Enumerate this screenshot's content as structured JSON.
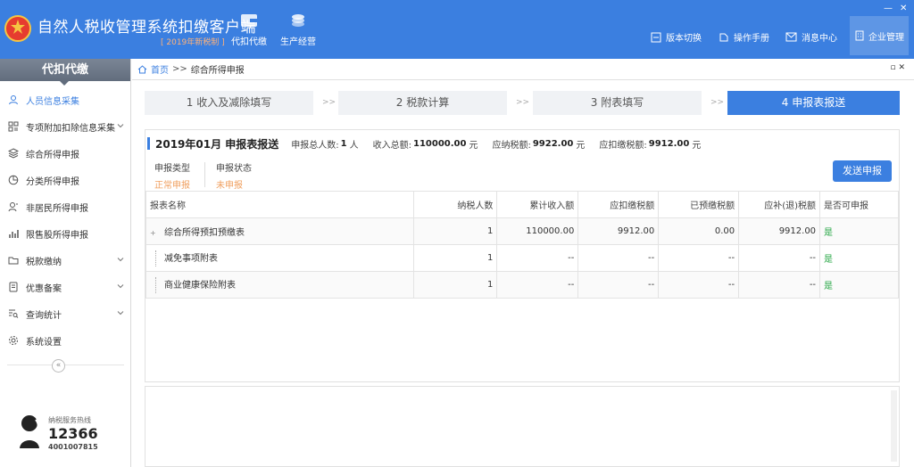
{
  "header": {
    "app_title": "自然人税收管理系统扣缴客户端",
    "edition": "[ 2019年新税制 ]",
    "nav": [
      {
        "label": "代扣代缴",
        "icon": "wallet-icon"
      },
      {
        "label": "生产经营",
        "icon": "coins-icon"
      }
    ],
    "links": [
      {
        "label": "版本切换",
        "icon": "switch-icon"
      },
      {
        "label": "操作手册",
        "icon": "manual-icon"
      },
      {
        "label": "消息中心",
        "icon": "mail-icon"
      },
      {
        "label": "企业管理",
        "icon": "building-icon"
      }
    ],
    "window_controls": {
      "minimize": "—",
      "close": "✕"
    },
    "brand_color": "#3b7fe0"
  },
  "sidebar": {
    "title": "代扣代缴",
    "items": [
      {
        "label": "人员信息采集",
        "icon": "person-icon",
        "active": true,
        "expandable": false
      },
      {
        "label": "专项附加扣除信息采集",
        "icon": "grid-icon",
        "active": false,
        "expandable": true
      },
      {
        "label": "综合所得申报",
        "icon": "layers-icon",
        "active": false,
        "expandable": false
      },
      {
        "label": "分类所得申报",
        "icon": "pie-icon",
        "active": false,
        "expandable": false
      },
      {
        "label": "非居民所得申报",
        "icon": "person-outline-icon",
        "active": false,
        "expandable": false
      },
      {
        "label": "限售股所得申报",
        "icon": "bar-icon",
        "active": false,
        "expandable": false
      },
      {
        "label": "税款缴纳",
        "icon": "folder-icon",
        "active": false,
        "expandable": true
      },
      {
        "label": "优惠备案",
        "icon": "doc-icon",
        "active": false,
        "expandable": true
      },
      {
        "label": "查询统计",
        "icon": "search-list-icon",
        "active": false,
        "expandable": true
      },
      {
        "label": "系统设置",
        "icon": "gear-icon",
        "active": false,
        "expandable": false
      }
    ],
    "collapse_label": "«",
    "hotline": {
      "caption": "纳税服务热线",
      "number": "12366",
      "sub": "4001007815"
    }
  },
  "breadcrumb": {
    "home": "首页",
    "sep": ">>",
    "current": "综合所得申报",
    "tools": "▫ ✕"
  },
  "steps": [
    {
      "label": "1 收入及减除填写",
      "active": false
    },
    {
      "label": "2 税款计算",
      "active": false
    },
    {
      "label": "3 附表填写",
      "active": false
    },
    {
      "label": "4 申报表报送",
      "active": true
    }
  ],
  "step_sep": ">>",
  "summary": {
    "title": "2019年01月  申报表报送",
    "people_label": "申报总人数:",
    "people_value": "1",
    "people_unit": "人",
    "income_label": "收入总额:",
    "income_value": "110000.00",
    "income_unit": "元",
    "tax_payable_label": "应纳税额:",
    "tax_payable_value": "9922.00",
    "tax_payable_unit": "元",
    "withheld_label": "应扣缴税额:",
    "withheld_value": "9912.00",
    "withheld_unit": "元",
    "report_type_label": "申报类型",
    "report_type_value": "正常申报",
    "report_status_label": "申报状态",
    "report_status_value": "未申报",
    "send_button": "发送申报"
  },
  "table": {
    "headers": [
      "报表名称",
      "纳税人数",
      "累计收入额",
      "应扣缴税额",
      "已预缴税额",
      "应补(退)税额",
      "是否可申报"
    ],
    "rows": [
      {
        "name": "综合所得预扣预缴表",
        "people": "1",
        "income": "110000.00",
        "withheld": "9912.00",
        "prepaid": "0.00",
        "due": "9912.00",
        "ok": "是"
      },
      {
        "name": "减免事项附表",
        "people": "1",
        "income": "--",
        "withheld": "--",
        "prepaid": "--",
        "due": "--",
        "ok": "是"
      },
      {
        "name": "商业健康保险附表",
        "people": "1",
        "income": "--",
        "withheld": "--",
        "prepaid": "--",
        "due": "--",
        "ok": "是"
      }
    ]
  }
}
